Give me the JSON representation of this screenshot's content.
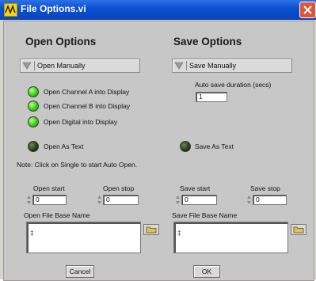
{
  "window": {
    "title": "File Options.vi"
  },
  "open": {
    "heading": "Open Options",
    "mode": "Open Manually",
    "leds": [
      {
        "label": "Open Channel A into Display",
        "state": "on"
      },
      {
        "label": "Open Channel B into Display",
        "state": "on"
      },
      {
        "label": "Open Digital into Display",
        "state": "on"
      }
    ],
    "as_text": {
      "label": "Open As Text",
      "state": "off"
    },
    "note": "Note: Click on Single to start Auto Open.",
    "start": {
      "label": "Open start",
      "value": "0"
    },
    "stop": {
      "label": "Open stop",
      "value": "0"
    },
    "file_base": {
      "label": "Open File Base Name",
      "value": ""
    }
  },
  "save": {
    "heading": "Save Options",
    "mode": "Save Manually",
    "duration": {
      "label": "Auto save duration (secs)",
      "value": "1"
    },
    "as_text": {
      "label": "Save As Text",
      "state": "off"
    },
    "start": {
      "label": "Save start",
      "value": "0"
    },
    "stop": {
      "label": "Save stop",
      "value": "0"
    },
    "file_base": {
      "label": "Save File Base Name",
      "value": ""
    }
  },
  "buttons": {
    "cancel": "Cancel",
    "ok": "OK"
  },
  "icons": {
    "app": "labview-icon",
    "close": "close-icon",
    "ring": "ring-arrow-icon",
    "browse": "folder-browse-icon",
    "path": "path-icon"
  },
  "colors": {
    "titlebar": "#0a4fd0",
    "panel": "#c7c7c7",
    "led_on": "#4ee32a",
    "led_off": "#2b3f1c"
  }
}
